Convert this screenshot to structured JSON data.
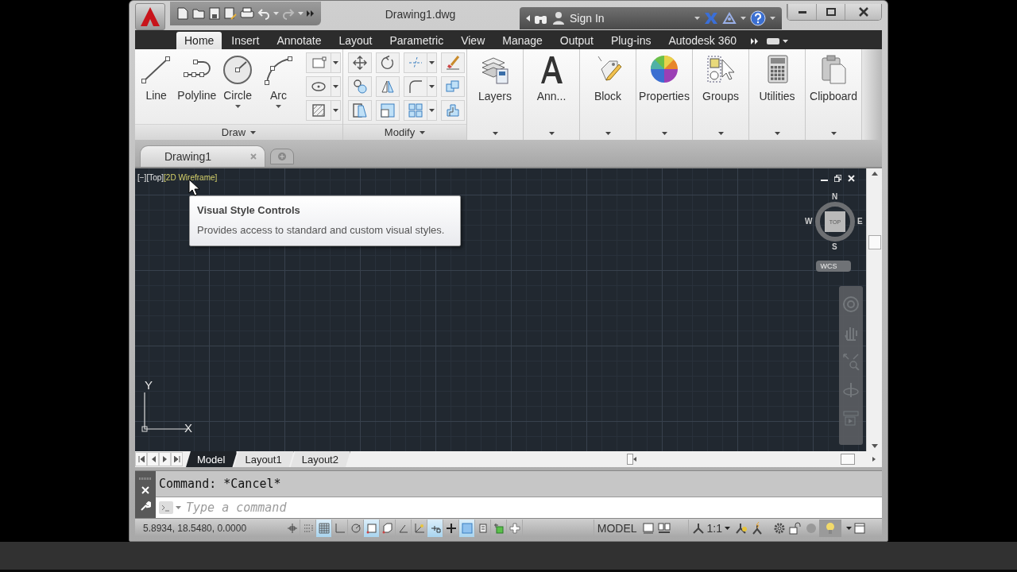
{
  "window": {
    "title": "Drawing1.dwg"
  },
  "info_center": {
    "sign_in": "Sign In"
  },
  "ribbon": {
    "tabs": [
      {
        "label": "Home",
        "selected": true
      },
      {
        "label": "Insert",
        "selected": false
      },
      {
        "label": "Annotate",
        "selected": false
      },
      {
        "label": "Layout",
        "selected": false
      },
      {
        "label": "Parametric",
        "selected": false
      },
      {
        "label": "View",
        "selected": false
      },
      {
        "label": "Manage",
        "selected": false
      },
      {
        "label": "Output",
        "selected": false
      },
      {
        "label": "Plug-ins",
        "selected": false
      },
      {
        "label": "Autodesk 360",
        "selected": false
      }
    ],
    "draw_panel": {
      "title": "Draw",
      "tools": [
        {
          "label": "Line",
          "kind": "line",
          "dropdown": false
        },
        {
          "label": "Polyline",
          "kind": "polyline",
          "dropdown": false
        },
        {
          "label": "Circle",
          "kind": "circle",
          "dropdown": true
        },
        {
          "label": "Arc",
          "kind": "arc",
          "dropdown": true
        }
      ],
      "small_tools": [
        {
          "kind": "rectangle"
        },
        {
          "kind": "ellipse"
        },
        {
          "kind": "hatch"
        }
      ]
    },
    "modify_panel": {
      "title": "Modify",
      "tools": [
        {
          "kind": "move",
          "split": false
        },
        {
          "kind": "rotate",
          "split": false
        },
        {
          "kind": "trim",
          "split": true
        },
        {
          "kind": "erase",
          "split": false
        },
        {
          "kind": "copy",
          "split": false
        },
        {
          "kind": "mirror",
          "split": false
        },
        {
          "kind": "fillet",
          "split": true
        },
        {
          "kind": "explode",
          "split": false
        },
        {
          "kind": "stretch",
          "split": false
        },
        {
          "kind": "scale",
          "split": false
        },
        {
          "kind": "array",
          "split": true
        },
        {
          "kind": "offset",
          "split": false
        }
      ]
    },
    "panels": [
      {
        "label": "Layers",
        "kind": "layers"
      },
      {
        "label": "Ann...",
        "kind": "annotation"
      },
      {
        "label": "Block",
        "kind": "block"
      },
      {
        "label": "Properties",
        "kind": "properties"
      },
      {
        "label": "Groups",
        "kind": "groups"
      },
      {
        "label": "Utilities",
        "kind": "utilities"
      },
      {
        "label": "Clipboard",
        "kind": "clipboard"
      }
    ]
  },
  "file_tabs": [
    {
      "label": "Drawing1",
      "selected": true
    }
  ],
  "viewport": {
    "controls": [
      {
        "label": "[−]",
        "hovered": false
      },
      {
        "label": "[Top]",
        "hovered": false
      },
      {
        "label": "[2D Wireframe]",
        "hovered": true
      }
    ],
    "tooltip": {
      "title": "Visual Style Controls",
      "text": "Provides access to standard and custom visual styles."
    },
    "viewcube": {
      "face": "TOP",
      "north": "N",
      "east": "E",
      "south": "S",
      "west": "W",
      "ucs": "WCS"
    },
    "ucs_icon": {
      "x": "X",
      "y": "Y"
    }
  },
  "layout_tabs": [
    {
      "label": "Model",
      "selected": true
    },
    {
      "label": "Layout1",
      "selected": false
    },
    {
      "label": "Layout2",
      "selected": false
    }
  ],
  "command": {
    "history": "Command: *Cancel*",
    "placeholder": "Type a command"
  },
  "status_bar": {
    "coordinates": "5.8934, 18.5480, 0.0000",
    "toggles": [
      {
        "on": false
      },
      {
        "on": false
      },
      {
        "on": true
      },
      {
        "on": false
      },
      {
        "on": false
      },
      {
        "on": true
      },
      {
        "on": false
      },
      {
        "on": false
      },
      {
        "on": false
      },
      {
        "on": true
      },
      {
        "on": false
      },
      {
        "on": true
      },
      {
        "on": false
      },
      {
        "on": false
      },
      {
        "on": false
      }
    ],
    "space": "MODEL",
    "scale": "1:1"
  }
}
